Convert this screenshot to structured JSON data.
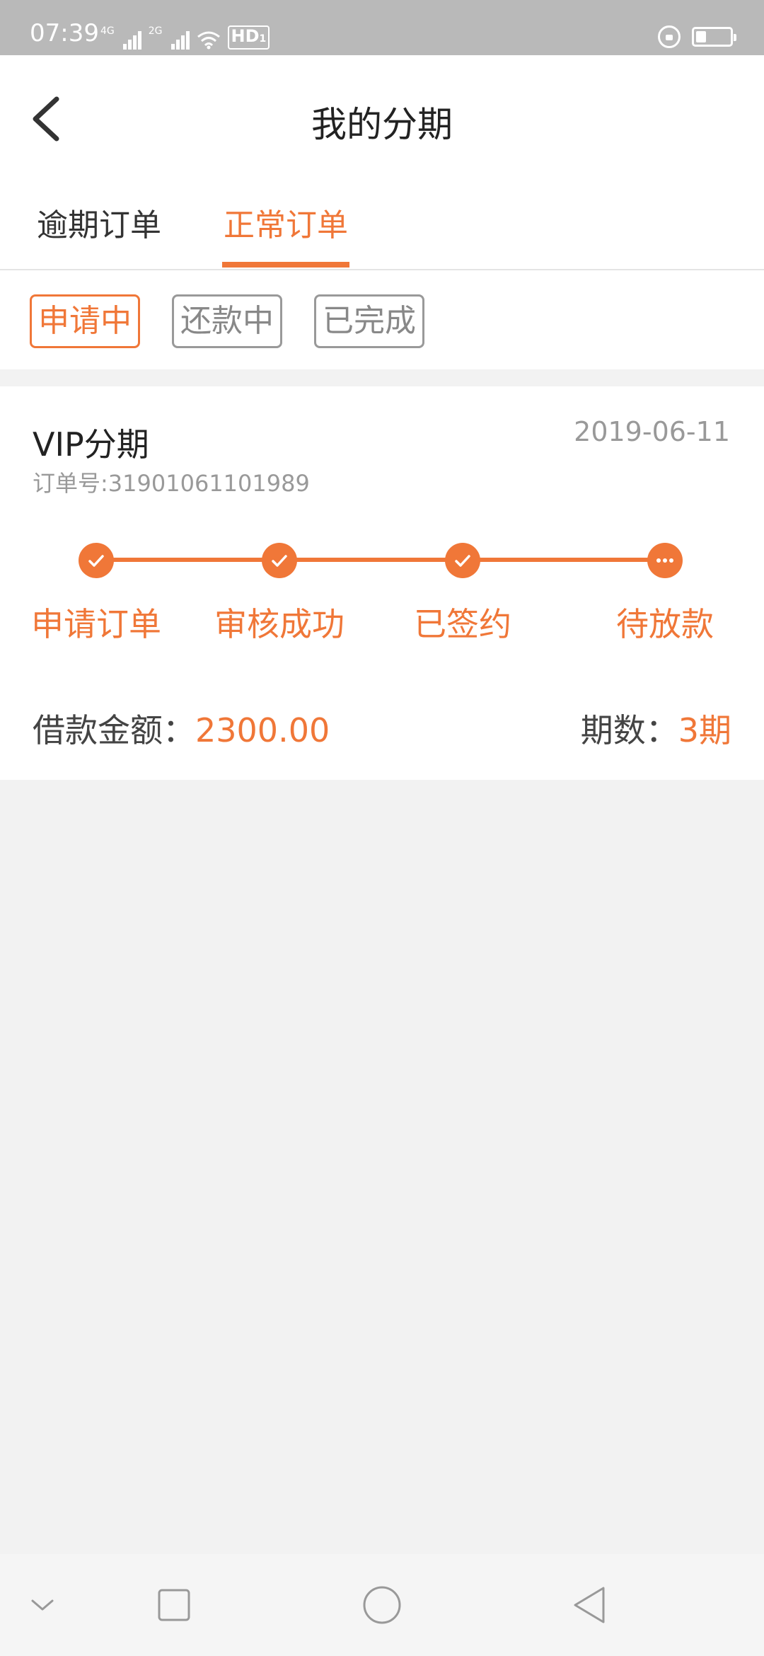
{
  "status_bar": {
    "time": "07:39",
    "network_1": "4G",
    "network_2": "2G",
    "hd_label": "HD",
    "hd_index": "1",
    "icons": [
      "signal-4g-icon",
      "signal-2g-icon",
      "wifi-icon",
      "hd-icon",
      "rotation-lock-icon",
      "battery-icon"
    ],
    "battery_level": 0.25
  },
  "header": {
    "title": "我的分期",
    "back_icon": "chevron-left-icon"
  },
  "tabs": [
    {
      "label": "逾期订单",
      "active": false
    },
    {
      "label": "正常订单",
      "active": true
    }
  ],
  "filters": [
    {
      "label": "申请中",
      "active": true
    },
    {
      "label": "还款中",
      "active": false
    },
    {
      "label": "已完成",
      "active": false
    }
  ],
  "order": {
    "title": "VIP分期",
    "date": "2019-06-11",
    "order_no_label": "订单号:",
    "order_no": "31901061101989",
    "steps": [
      {
        "label": "申请订单",
        "status": "done",
        "icon": "check-icon"
      },
      {
        "label": "审核成功",
        "status": "done",
        "icon": "check-icon"
      },
      {
        "label": "已签约",
        "status": "done",
        "icon": "check-icon"
      },
      {
        "label": "待放款",
        "status": "pending",
        "icon": "more-dots-icon"
      }
    ],
    "amount_label": "借款金额：",
    "amount_value": "2300.00",
    "period_label": "期数：",
    "period_value": "3期"
  },
  "nav_bar": {
    "icons": [
      "collapse-chevron-icon",
      "recent-apps-icon",
      "home-icon",
      "back-triangle-icon"
    ]
  },
  "colors": {
    "accent": "#f07738",
    "background": "#f2f2f2",
    "status_bar": "#b9b9b9"
  }
}
